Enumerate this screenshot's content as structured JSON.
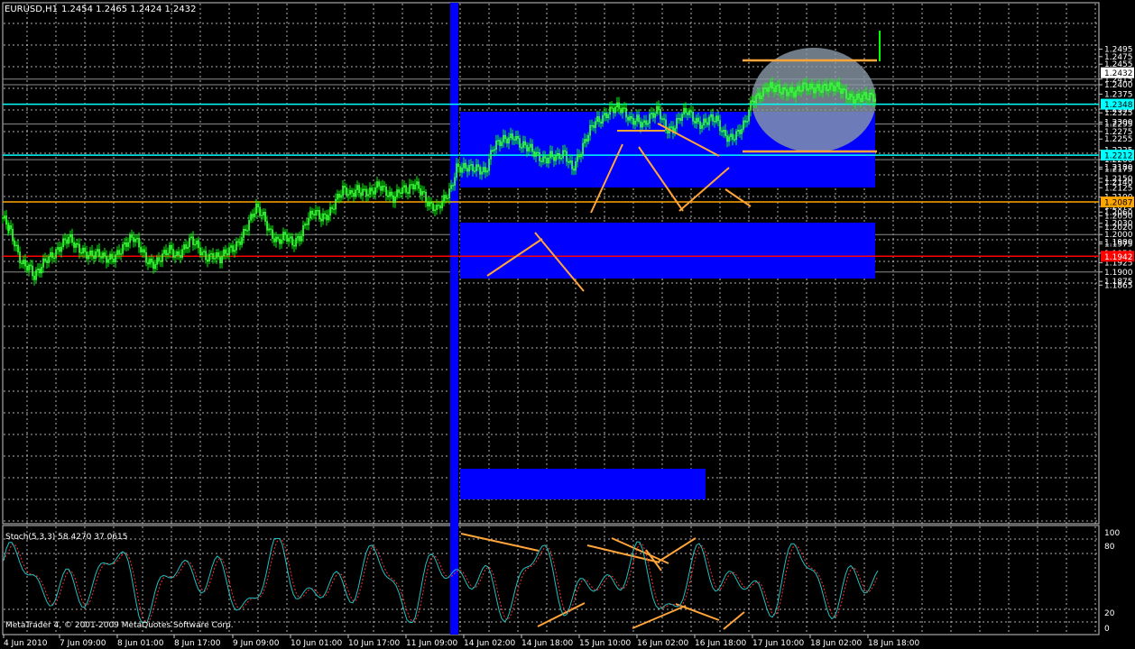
{
  "header": {
    "symbol_tf": "EURUSD,H1",
    "ohlc": "1.2454 1.2465 1.2424 1.2432"
  },
  "indicator": {
    "label": "Stoch(5,3,3) 58.4270 37.0615",
    "levels": [
      "100",
      "80",
      "20",
      "0"
    ]
  },
  "watermark": "MetaTrader 4, © 2001-2009 MetaQuotes Software Corp.",
  "colors": {
    "background": "#000000",
    "candle": "#00ff00",
    "candle_edge": "#66ff66",
    "zone": "#0000ff",
    "hline_cyan": "#00ffff",
    "hline_orange": "#ffa500",
    "hline_red": "#ff0000",
    "trend": "#ffa53a",
    "stoch_main": "#20c0c0",
    "stoch_signal": "#ff3030"
  },
  "price_axis": {
    "labels": [
      "1.2495",
      "1.2475",
      "1.2455",
      "1.2415",
      "1.2400",
      "1.2375",
      "1.2335",
      "1.2325",
      "1.2300",
      "1.2295",
      "1.2275",
      "1.2255",
      "1.2225",
      "1.2200",
      "1.2180",
      "1.2175",
      "1.2150",
      "1.2140",
      "1.2125",
      "1.2100",
      "1.2075",
      "1.2060",
      "1.2050",
      "1.2030",
      "1.2020",
      "1.2000",
      "1.1980",
      "1.1975",
      "1.1950",
      "1.1925",
      "1.1900",
      "1.1875",
      "1.1865"
    ],
    "badges": [
      {
        "value": "1.2432",
        "bg": "#ffffff",
        "fg": "#000000"
      },
      {
        "value": "1.2348",
        "bg": "#00ffff",
        "fg": "#000000"
      },
      {
        "value": "1.2212",
        "bg": "#00ffff",
        "fg": "#000000"
      },
      {
        "value": "1.2087",
        "bg": "#ffa500",
        "fg": "#000000"
      },
      {
        "value": "1.1942",
        "bg": "#ff0000",
        "fg": "#ffffff"
      }
    ]
  },
  "time_axis": {
    "labels": [
      "4 Jun 2010",
      "7 Jun 09:00",
      "8 Jun 01:00",
      "8 Jun 17:00",
      "9 Jun 09:00",
      "10 Jun 01:00",
      "10 Jun 17:00",
      "11 Jun 09:00",
      "14 Jun 02:00",
      "14 Jun 18:00",
      "15 Jun 10:00",
      "16 Jun 02:00",
      "16 Jun 18:00",
      "17 Jun 10:00",
      "18 Jun 02:00",
      "18 Jun 18:00"
    ]
  }
}
